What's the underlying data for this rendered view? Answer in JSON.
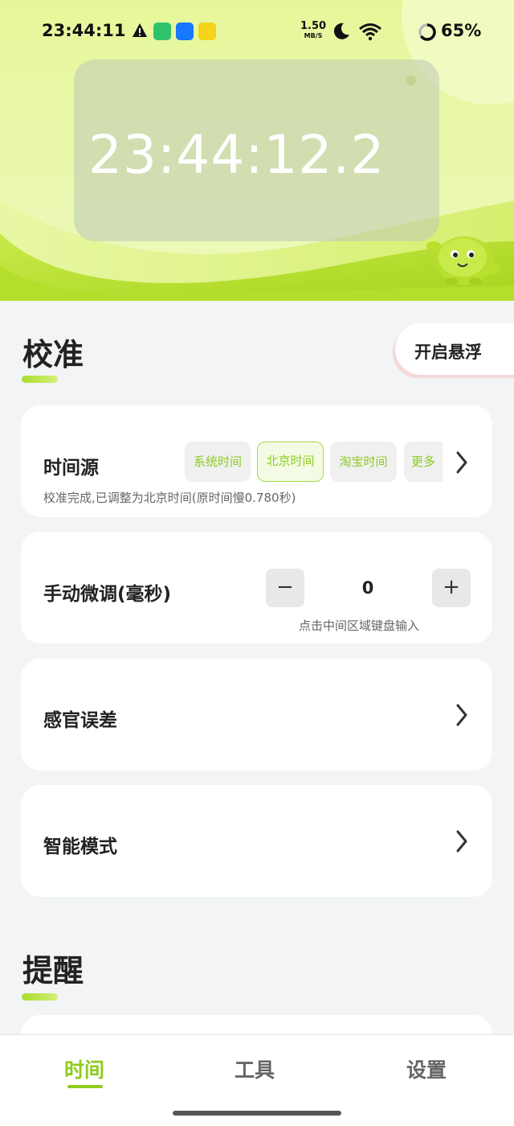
{
  "status_bar": {
    "time": "23:44:11",
    "net_speed_value": "1.50",
    "net_speed_unit": "MB/S",
    "battery_percent": "65%"
  },
  "clock": {
    "display": "23:44:12.2"
  },
  "calibration": {
    "title": "校准",
    "float_button": "开启悬浮",
    "time_source": {
      "label": "时间源",
      "options": [
        "系统时间",
        "北京时间",
        "淘宝时间",
        "更多"
      ],
      "selected": "北京时间",
      "note": "校准完成,已调整为北京时间(原时间慢0.780秒)"
    },
    "manual_adjust": {
      "label": "手动微调(毫秒)",
      "minus": "−",
      "plus": "+",
      "value": "0",
      "hint": "点击中间区域键盘输入"
    },
    "sensory_error": {
      "label": "感官误差"
    },
    "smart_mode": {
      "label": "智能模式"
    }
  },
  "reminder": {
    "title": "提醒"
  },
  "nav": {
    "items": [
      "时间",
      "工具",
      "设置"
    ],
    "active": "时间"
  },
  "colors": {
    "accent": "#8ccc1c",
    "background": "#f2f4f5",
    "card": "#ffffff"
  }
}
